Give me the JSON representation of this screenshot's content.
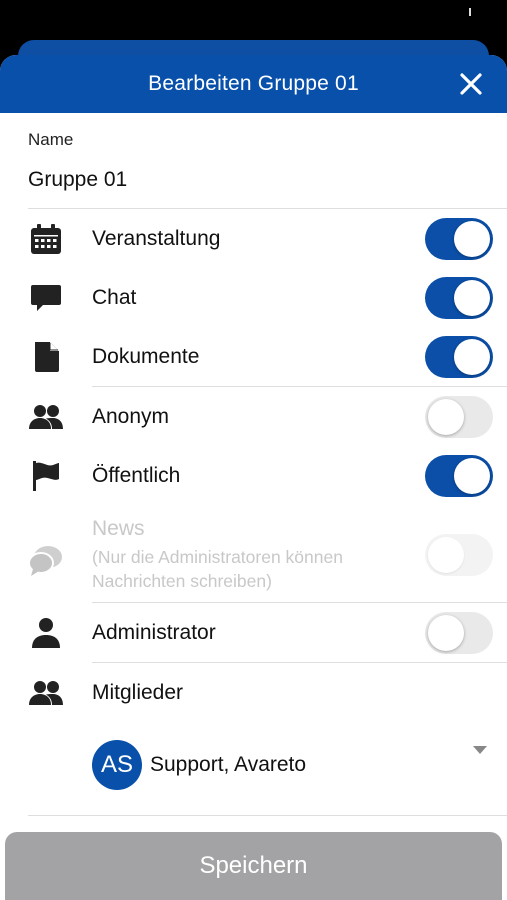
{
  "header": {
    "title": "Bearbeiten Gruppe 01"
  },
  "name_field": {
    "label": "Name",
    "value": "Gruppe 01"
  },
  "settings": [
    {
      "key": "event",
      "label": "Veranstaltung",
      "icon": "calendar-icon",
      "enabled": true
    },
    {
      "key": "chat",
      "label": "Chat",
      "icon": "chat-bubble-icon",
      "enabled": true
    },
    {
      "key": "documents",
      "label": "Dokumente",
      "icon": "document-icon",
      "enabled": true
    },
    {
      "key": "anonymous",
      "label": "Anonym",
      "icon": "group-icon",
      "enabled": false
    },
    {
      "key": "public",
      "label": "Öffentlich",
      "icon": "flag-icon",
      "enabled": true
    }
  ],
  "news": {
    "title": "News",
    "subtitle": "(Nur die Administratoren können Nachrichten schreiben)",
    "icon": "chat-bubbles-icon",
    "enabled": false,
    "disabled": true
  },
  "admin": {
    "label": "Administrator",
    "icon": "person-icon",
    "enabled": false
  },
  "members": {
    "label": "Mitglieder",
    "icon": "group-icon",
    "list": [
      {
        "initials": "AS",
        "name": "Support, Avareto"
      }
    ]
  },
  "footer": {
    "save_label": "Speichern"
  },
  "colors": {
    "primary": "#0850aa",
    "toggle_on": "#0b4fa8",
    "toggle_off": "#e9e9ea",
    "save_disabled": "#a3a3a5"
  }
}
